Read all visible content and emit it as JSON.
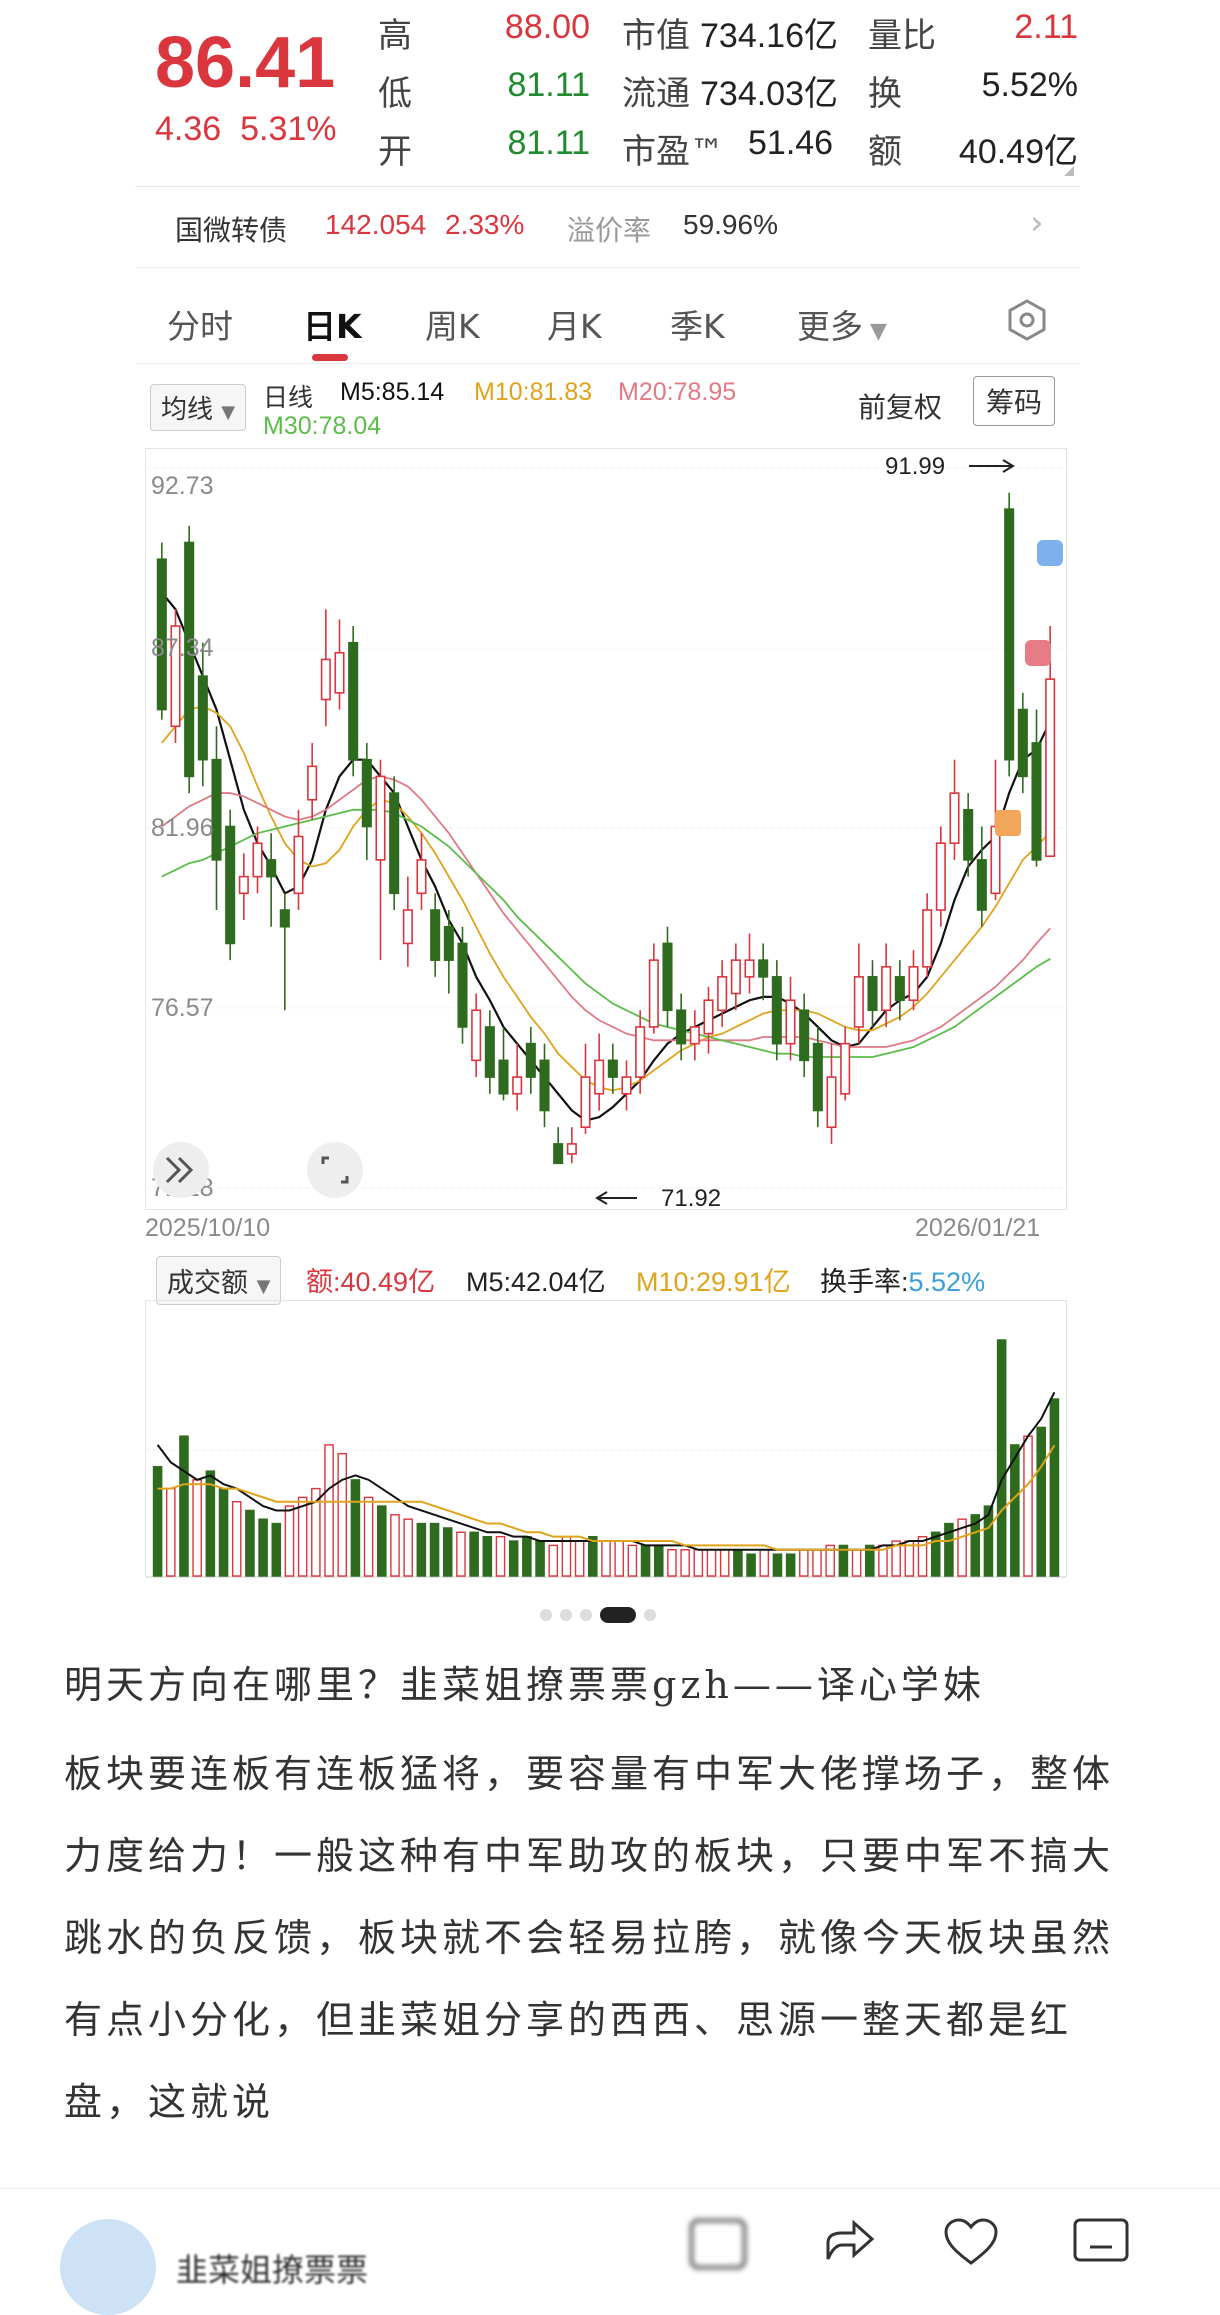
{
  "quote": {
    "price": "86.41",
    "change": "4.36",
    "change_pct": "5.31%",
    "high_label": "高",
    "high": "88.00",
    "low_label": "低",
    "low": "81.11",
    "open_label": "开",
    "open": "81.11",
    "mktcap_label": "市值",
    "mktcap": "734.16亿",
    "float_label": "流通",
    "float": "734.03亿",
    "pe_label": "市盈™",
    "pe": "51.46",
    "volratio_label": "量比",
    "volratio": "2.11",
    "turnover_label": "换",
    "turnover": "5.52%",
    "amount_label": "额",
    "amount": "40.49亿"
  },
  "bond": {
    "name": "国微转债",
    "price": "142.054",
    "pct": "2.33%",
    "premium_label": "溢价率",
    "premium": "59.96%"
  },
  "tabs": [
    "分时",
    "日K",
    "周K",
    "月K",
    "季K",
    "更多"
  ],
  "active_tab": "日K",
  "chart_header": {
    "ma_select": "均线",
    "period": "日线",
    "m5": "M5:85.14",
    "m10": "M10:81.83",
    "m20": "M20:78.95",
    "m30": "M30:78.04",
    "adjust": "前复权",
    "chips_button": "筹码"
  },
  "volume_header": {
    "select": "成交额",
    "amount": "额:40.49亿",
    "m5": "M5:42.04亿",
    "m10": "M10:29.91亿",
    "turnover_label": "换手率:",
    "turnover": "5.52%"
  },
  "colors": {
    "up": "#d9363e",
    "down": "#2f6b1f",
    "m5": "#111111",
    "m10": "#e0a31c",
    "m20": "#e07a86",
    "m30": "#5cbd4a"
  },
  "chart_data": [
    {
      "type": "candlestick",
      "y_ticks": [
        "92.73",
        "87.34",
        "81.96",
        "76.57",
        "71.18"
      ],
      "ylim": [
        71.18,
        92.73
      ],
      "x_start": "2025/10/10",
      "x_end": "2026/01/21",
      "annotations": {
        "high": "91.99",
        "low": "71.92"
      },
      "candles": [
        {
          "o": 90.0,
          "c": 85.5,
          "h": 90.5,
          "l": 85.2
        },
        {
          "o": 85.0,
          "c": 88.0,
          "h": 88.5,
          "l": 84.5
        },
        {
          "o": 90.5,
          "c": 83.5,
          "h": 91.0,
          "l": 83.0
        },
        {
          "o": 86.5,
          "c": 84.0,
          "h": 87.5,
          "l": 83.2
        },
        {
          "o": 84.0,
          "c": 81.0,
          "h": 85.0,
          "l": 79.5
        },
        {
          "o": 82.0,
          "c": 78.5,
          "h": 82.5,
          "l": 78.0
        },
        {
          "o": 80.0,
          "c": 80.5,
          "h": 81.2,
          "l": 79.2
        },
        {
          "o": 80.5,
          "c": 81.5,
          "h": 82.0,
          "l": 80.0
        },
        {
          "o": 81.0,
          "c": 80.5,
          "h": 81.8,
          "l": 79.0
        },
        {
          "o": 79.5,
          "c": 79.0,
          "h": 80.0,
          "l": 76.5
        },
        {
          "o": 80.0,
          "c": 81.7,
          "h": 82.5,
          "l": 79.5
        },
        {
          "o": 82.8,
          "c": 83.8,
          "h": 84.5,
          "l": 82.2
        },
        {
          "o": 85.8,
          "c": 87.0,
          "h": 88.5,
          "l": 85.0
        },
        {
          "o": 86.0,
          "c": 87.2,
          "h": 88.2,
          "l": 85.5
        },
        {
          "o": 87.5,
          "c": 84.0,
          "h": 88.0,
          "l": 83.5
        },
        {
          "o": 84.0,
          "c": 82.0,
          "h": 84.5,
          "l": 81.0
        },
        {
          "o": 81.0,
          "c": 83.5,
          "h": 84.0,
          "l": 78.0
        },
        {
          "o": 83.0,
          "c": 80.0,
          "h": 83.5,
          "l": 79.5
        },
        {
          "o": 78.5,
          "c": 79.5,
          "h": 80.5,
          "l": 77.8
        },
        {
          "o": 80.0,
          "c": 81.0,
          "h": 81.8,
          "l": 79.5
        },
        {
          "o": 79.5,
          "c": 78.0,
          "h": 80.0,
          "l": 77.5
        },
        {
          "o": 79.0,
          "c": 78.0,
          "h": 79.5,
          "l": 77.0
        },
        {
          "o": 78.5,
          "c": 76.0,
          "h": 79.0,
          "l": 75.5
        },
        {
          "o": 75.0,
          "c": 76.5,
          "h": 77.0,
          "l": 74.5
        },
        {
          "o": 76.0,
          "c": 74.5,
          "h": 76.5,
          "l": 74.0
        },
        {
          "o": 75.0,
          "c": 74.0,
          "h": 76.0,
          "l": 73.8
        },
        {
          "o": 74.0,
          "c": 74.5,
          "h": 75.5,
          "l": 73.5
        },
        {
          "o": 75.5,
          "c": 74.5,
          "h": 76.0,
          "l": 74.0
        },
        {
          "o": 75.0,
          "c": 73.5,
          "h": 75.5,
          "l": 73.0
        },
        {
          "o": 72.5,
          "c": 71.92,
          "h": 73.0,
          "l": 71.92
        },
        {
          "o": 72.2,
          "c": 72.5,
          "h": 73.0,
          "l": 71.92
        },
        {
          "o": 73.0,
          "c": 74.5,
          "h": 75.5,
          "l": 72.8
        },
        {
          "o": 74.0,
          "c": 75.0,
          "h": 75.8,
          "l": 73.5
        },
        {
          "o": 75.0,
          "c": 74.5,
          "h": 75.5,
          "l": 74.0
        },
        {
          "o": 74.0,
          "c": 74.5,
          "h": 75.0,
          "l": 73.5
        },
        {
          "o": 74.5,
          "c": 76.0,
          "h": 76.5,
          "l": 74.0
        },
        {
          "o": 76.0,
          "c": 78.0,
          "h": 78.5,
          "l": 75.8
        },
        {
          "o": 78.5,
          "c": 76.5,
          "h": 79.0,
          "l": 76.0
        },
        {
          "o": 76.5,
          "c": 75.5,
          "h": 77.0,
          "l": 75.0
        },
        {
          "o": 75.5,
          "c": 76.0,
          "h": 76.5,
          "l": 75.0
        },
        {
          "o": 75.8,
          "c": 76.8,
          "h": 77.2,
          "l": 75.2
        },
        {
          "o": 76.5,
          "c": 77.5,
          "h": 78.0,
          "l": 76.0
        },
        {
          "o": 77.0,
          "c": 78.0,
          "h": 78.5,
          "l": 76.5
        },
        {
          "o": 77.5,
          "c": 78.0,
          "h": 78.8,
          "l": 77.0
        },
        {
          "o": 78.0,
          "c": 77.5,
          "h": 78.5,
          "l": 76.8
        },
        {
          "o": 77.5,
          "c": 75.5,
          "h": 78.0,
          "l": 75.0
        },
        {
          "o": 75.5,
          "c": 76.8,
          "h": 77.5,
          "l": 75.0
        },
        {
          "o": 76.5,
          "c": 75.0,
          "h": 77.0,
          "l": 74.5
        },
        {
          "o": 75.5,
          "c": 73.5,
          "h": 76.0,
          "l": 73.0
        },
        {
          "o": 73.0,
          "c": 74.5,
          "h": 75.5,
          "l": 72.5
        },
        {
          "o": 74.0,
          "c": 75.5,
          "h": 76.0,
          "l": 73.8
        },
        {
          "o": 76.0,
          "c": 77.5,
          "h": 78.5,
          "l": 75.5
        },
        {
          "o": 77.5,
          "c": 76.5,
          "h": 78.0,
          "l": 76.0
        },
        {
          "o": 76.5,
          "c": 77.8,
          "h": 78.5,
          "l": 76.0
        },
        {
          "o": 77.5,
          "c": 76.8,
          "h": 78.0,
          "l": 76.2
        },
        {
          "o": 76.8,
          "c": 77.8,
          "h": 78.3,
          "l": 76.5
        },
        {
          "o": 77.8,
          "c": 79.5,
          "h": 80.0,
          "l": 77.5
        },
        {
          "o": 79.5,
          "c": 81.5,
          "h": 82.0,
          "l": 79.0
        },
        {
          "o": 81.5,
          "c": 83.0,
          "h": 84.0,
          "l": 81.0
        },
        {
          "o": 82.5,
          "c": 81.0,
          "h": 83.0,
          "l": 80.5
        },
        {
          "o": 81.0,
          "c": 79.5,
          "h": 82.0,
          "l": 79.0
        },
        {
          "o": 80.0,
          "c": 82.0,
          "h": 84.0,
          "l": 79.8
        },
        {
          "o": 91.5,
          "c": 84.0,
          "h": 91.99,
          "l": 83.5
        },
        {
          "o": 85.5,
          "c": 83.5,
          "h": 86.0,
          "l": 83.0
        },
        {
          "o": 84.5,
          "c": 81.0,
          "h": 85.5,
          "l": 80.8
        },
        {
          "o": 81.11,
          "c": 86.41,
          "h": 88.0,
          "l": 81.11
        }
      ],
      "series": [
        {
          "name": "M5",
          "values": [
            89.0,
            88.5,
            87.5,
            86.5,
            85.5,
            84.0,
            82.5,
            81.5,
            80.8,
            80.0,
            80.2,
            81.0,
            82.5,
            83.5,
            84.0,
            84.0,
            83.5,
            83.0,
            82.0,
            81.0,
            80.2,
            79.2,
            78.5,
            77.5,
            76.8,
            76.0,
            75.5,
            75.0,
            74.5,
            74.0,
            73.5,
            73.2,
            73.3,
            73.6,
            74.0,
            74.4,
            75.0,
            75.5,
            75.8,
            76.0,
            76.2,
            76.4,
            76.6,
            76.8,
            76.9,
            76.9,
            76.7,
            76.4,
            76.0,
            75.6,
            75.4,
            75.5,
            76.0,
            76.5,
            76.8,
            77.0,
            77.5,
            78.5,
            79.8,
            80.8,
            81.3,
            81.7,
            83.0,
            84.0,
            84.3,
            85.14
          ]
        },
        {
          "name": "M10",
          "values": [
            84.5,
            85.0,
            85.5,
            85.6,
            85.4,
            85.0,
            84.2,
            83.2,
            82.3,
            81.5,
            81.0,
            80.8,
            80.9,
            81.3,
            82.0,
            82.5,
            82.8,
            82.7,
            82.3,
            81.8,
            81.2,
            80.5,
            79.8,
            79.0,
            78.2,
            77.5,
            76.9,
            76.3,
            75.8,
            75.2,
            74.8,
            74.4,
            74.2,
            74.1,
            74.2,
            74.4,
            74.7,
            75.0,
            75.3,
            75.5,
            75.7,
            75.8,
            76.0,
            76.2,
            76.4,
            76.5,
            76.5,
            76.5,
            76.4,
            76.2,
            76.0,
            75.9,
            75.9,
            76.1,
            76.3,
            76.6,
            77.0,
            77.5,
            78.0,
            78.5,
            79.0,
            79.6,
            80.3,
            81.0,
            81.4,
            81.83
          ]
        },
        {
          "name": "M20",
          "values": [
            82.0,
            82.3,
            82.6,
            82.8,
            83.0,
            83.0,
            82.9,
            82.7,
            82.5,
            82.3,
            82.2,
            82.3,
            82.5,
            82.8,
            83.1,
            83.4,
            83.5,
            83.4,
            83.2,
            82.8,
            82.3,
            81.8,
            81.2,
            80.6,
            80.0,
            79.4,
            78.9,
            78.4,
            77.9,
            77.4,
            76.9,
            76.5,
            76.2,
            76.0,
            75.8,
            75.7,
            75.6,
            75.6,
            75.6,
            75.6,
            75.6,
            75.6,
            75.6,
            75.6,
            75.7,
            75.7,
            75.7,
            75.7,
            75.6,
            75.5,
            75.4,
            75.4,
            75.4,
            75.4,
            75.5,
            75.6,
            75.8,
            76.0,
            76.3,
            76.6,
            76.9,
            77.2,
            77.6,
            78.0,
            78.5,
            78.95
          ]
        },
        {
          "name": "M30",
          "values": [
            80.5,
            80.7,
            80.9,
            81.0,
            81.2,
            81.4,
            81.6,
            81.8,
            81.9,
            82.0,
            82.1,
            82.2,
            82.3,
            82.4,
            82.5,
            82.5,
            82.5,
            82.4,
            82.2,
            82.0,
            81.7,
            81.4,
            81.0,
            80.6,
            80.2,
            79.8,
            79.3,
            78.9,
            78.5,
            78.1,
            77.7,
            77.3,
            77.0,
            76.7,
            76.5,
            76.3,
            76.1,
            76.0,
            75.9,
            75.8,
            75.7,
            75.6,
            75.5,
            75.4,
            75.3,
            75.2,
            75.2,
            75.1,
            75.1,
            75.1,
            75.1,
            75.1,
            75.1,
            75.2,
            75.3,
            75.4,
            75.6,
            75.8,
            76.0,
            76.3,
            76.6,
            76.9,
            77.2,
            77.5,
            77.8,
            78.04
          ]
        }
      ]
    },
    {
      "type": "bar",
      "title": "成交额",
      "unit": "亿",
      "values": [
        25,
        20,
        32,
        22,
        24,
        20,
        17,
        15,
        13,
        12,
        16,
        18,
        20,
        30,
        28,
        22,
        18,
        16,
        14,
        13,
        12,
        12,
        11,
        10,
        10,
        9,
        9,
        8,
        9,
        8,
        7,
        9,
        8,
        9,
        8,
        8,
        7,
        7,
        7,
        6,
        6,
        6,
        6,
        6,
        6,
        5,
        6,
        5,
        5,
        6,
        6,
        7,
        7,
        6,
        7,
        7,
        8,
        8,
        9,
        10,
        12,
        13,
        14,
        16,
        54,
        30,
        32,
        34,
        40.49
      ],
      "up": [
        false,
        true,
        false,
        true,
        false,
        false,
        true,
        false,
        false,
        false,
        true,
        true,
        true,
        true,
        true,
        false,
        true,
        false,
        true,
        true,
        false,
        false,
        false,
        true,
        false,
        false,
        true,
        false,
        false,
        false,
        true,
        true,
        true,
        false,
        true,
        true,
        true,
        false,
        false,
        true,
        true,
        true,
        true,
        true,
        false,
        false,
        true,
        false,
        false,
        true,
        true,
        true,
        false,
        true,
        false,
        true,
        true,
        true,
        true,
        false,
        false,
        true,
        false,
        false,
        false,
        false,
        true
      ],
      "series": [
        {
          "name": "M5",
          "values": [
            30,
            26,
            24,
            22,
            23,
            21,
            20,
            18,
            16,
            15,
            15,
            16,
            17,
            20,
            22,
            23,
            22,
            20,
            18,
            16,
            15,
            14,
            13,
            12,
            11,
            10,
            10,
            9,
            9,
            8,
            8,
            8,
            8,
            8,
            8,
            8,
            8,
            7,
            7,
            7,
            7,
            6,
            6,
            6,
            6,
            6,
            6,
            6,
            6,
            6,
            6,
            6,
            6,
            6,
            6,
            7,
            7,
            8,
            8,
            9,
            10,
            11,
            12,
            14,
            22,
            27,
            32,
            36,
            42.04
          ]
        },
        {
          "name": "M10",
          "values": [
            20,
            20,
            21,
            21,
            21,
            20,
            20,
            19,
            18,
            17,
            17,
            17,
            17,
            17,
            17,
            17,
            17,
            17,
            17,
            17,
            17,
            16,
            15,
            14,
            13,
            12,
            12,
            11,
            10,
            10,
            9,
            9,
            9,
            8,
            8,
            8,
            8,
            8,
            8,
            8,
            7,
            7,
            7,
            7,
            7,
            7,
            7,
            6,
            6,
            6,
            6,
            6,
            6,
            6,
            6,
            6,
            7,
            7,
            7,
            8,
            8,
            9,
            10,
            11,
            15,
            18,
            21,
            25,
            29.91
          ]
        }
      ]
    }
  ],
  "article": {
    "line1": "明天方向在哪里？韭菜姐撩票票gzh——译心学妹",
    "line2": "板块要连板有连板猛将，要容量有中军大佬撑场子，整体力度给力！一般这种有中军助攻的板块，只要中军不搞大跳水的负反馈，板块就不会轻易拉胯，就像今天板块虽然有点小分化，但韭菜姐分享的西西、思源一整天都是红盘，这就说"
  },
  "bottom_bar": {
    "author": "韭菜姐撩票票"
  }
}
